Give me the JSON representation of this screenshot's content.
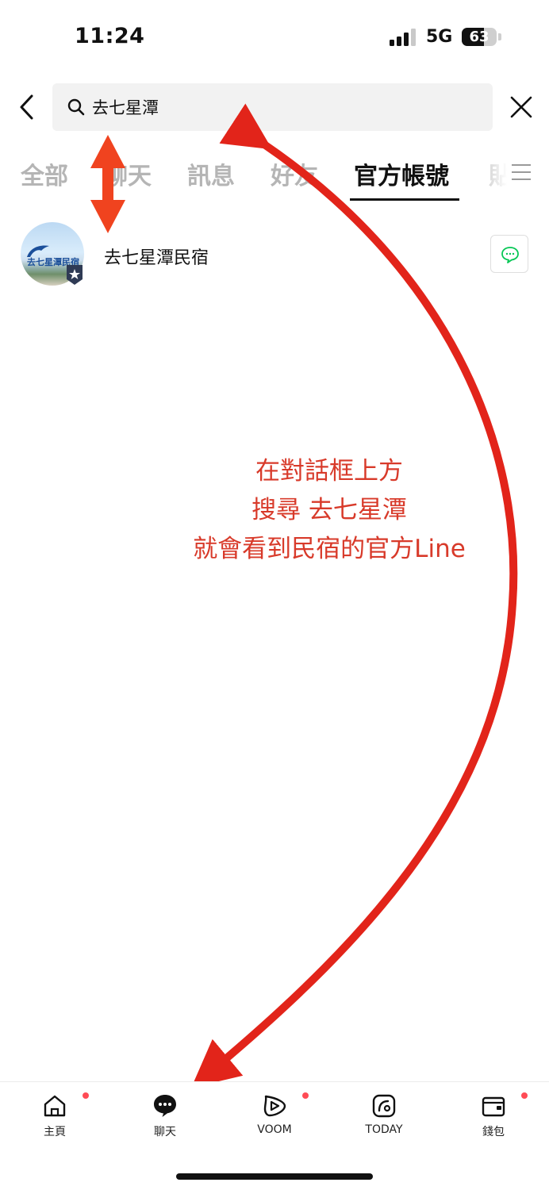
{
  "status_bar": {
    "time": "11:24",
    "network": "5G",
    "battery_percent": "63",
    "battery_level": 0.63
  },
  "search": {
    "query": "去七星潭",
    "placeholder": ""
  },
  "tabs": [
    {
      "label": "全部",
      "active": false
    },
    {
      "label": "聊天",
      "active": false
    },
    {
      "label": "訊息",
      "active": false
    },
    {
      "label": "好友",
      "active": false
    },
    {
      "label": "官方帳號",
      "active": true
    },
    {
      "label": "貼",
      "active": false
    }
  ],
  "results": [
    {
      "name": "去七星潭民宿",
      "avatar_text": "去七星潭民宿",
      "badge_icon": "star-badge-icon",
      "action_icon": "chat-bubble-icon"
    }
  ],
  "annotation": {
    "lines": [
      "在對話框上方",
      "搜尋 去七星潭",
      "就會看到民宿的官方Line"
    ],
    "color": "#d83a2a"
  },
  "colors": {
    "accent_green": "#06c755",
    "annotation_red": "#d83a2a",
    "notification_dot": "#ff4b55"
  },
  "bottom_nav": [
    {
      "label": "主頁",
      "icon": "home-icon",
      "dot": true
    },
    {
      "label": "聊天",
      "icon": "chat-icon",
      "dot": false
    },
    {
      "label": "VOOM",
      "icon": "voom-icon",
      "dot": true
    },
    {
      "label": "TODAY",
      "icon": "today-icon",
      "dot": false
    },
    {
      "label": "錢包",
      "icon": "wallet-icon",
      "dot": true
    }
  ]
}
